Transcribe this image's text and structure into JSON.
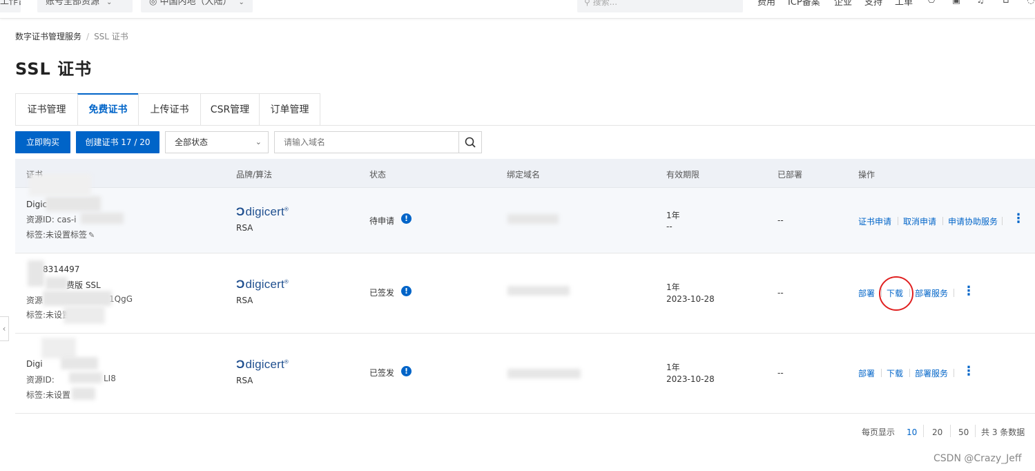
{
  "topbar": {
    "workbench": "工作台",
    "account_scope": "账号全部资源",
    "region": "中国内地（大陆）",
    "search_placeholder": "搜索...",
    "links": [
      "费用",
      "ICP备案",
      "企业",
      "支持",
      "工单"
    ]
  },
  "breadcrumb": {
    "root": "数字证书管理服务",
    "sep": "/",
    "current": "SSL 证书"
  },
  "page_title": "SSL 证书",
  "tabs": [
    "证书管理",
    "免费证书",
    "上传证书",
    "CSR管理",
    "订单管理"
  ],
  "toolbar": {
    "buy_label": "立即购买",
    "create_label": "创建证书 17 / 20",
    "status_select": "全部状态",
    "domain_placeholder": "请输入域名"
  },
  "table": {
    "columns": [
      "证书",
      "品牌/算法",
      "状态",
      "绑定域名",
      "有效期限",
      "已部署",
      "操作"
    ],
    "rows": [
      {
        "cert_name": "Digic",
        "resource_id": "资源ID: cas-i",
        "tag": "标签:未设置标签",
        "brand": "digicert",
        "algo": "RSA",
        "status": "待申请",
        "validity": "1年",
        "expires": "--",
        "deployed": "--",
        "actions": [
          "证书申请",
          "取消申请",
          "申请协助服务"
        ]
      },
      {
        "cert_name": "8314497",
        "cert_type": "费版 SSL",
        "resource_id": "资源",
        "resource_suffix": "1QgG",
        "tag": "标签:未设置",
        "brand": "digicert",
        "algo": "RSA",
        "status": "已签发",
        "validity": "1年",
        "expires": "2023-10-28",
        "deployed": "--",
        "actions": [
          "部署",
          "下载",
          "部署服务"
        ]
      },
      {
        "cert_name": "Digi",
        "resource_id": "资源ID:",
        "resource_suffix": "LI8",
        "tag": "标签:未设置",
        "brand": "digicert",
        "algo": "RSA",
        "status": "已签发",
        "validity": "1年",
        "expires": "2023-10-28",
        "deployed": "--",
        "actions": [
          "部署",
          "下载",
          "部署服务"
        ]
      }
    ]
  },
  "pagination": {
    "per_page_label": "每页显示",
    "sizes": [
      "10",
      "20",
      "50"
    ],
    "active_size": "10",
    "total": "共 3 条数据"
  },
  "watermark": "CSDN @Crazy_Jeff",
  "colors": {
    "primary": "#0064c8",
    "highlight_circle": "#e02020",
    "header_bg": "#eef1f6"
  }
}
